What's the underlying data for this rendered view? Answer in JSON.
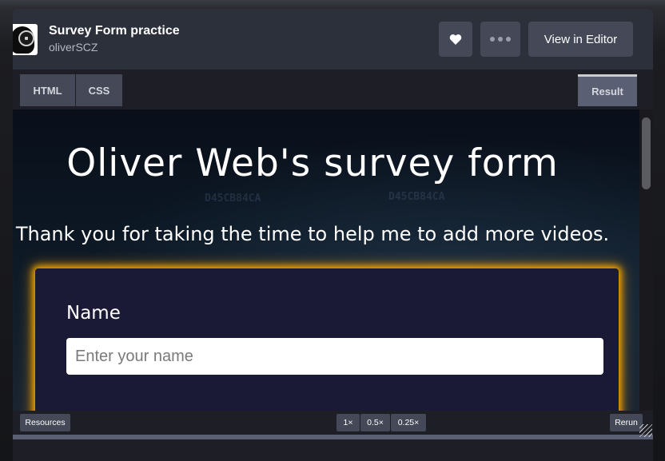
{
  "header": {
    "title": "Survey Form practice",
    "author": "oliverSCZ",
    "more_icon": "more-dots-icon",
    "heart_icon": "heart-icon",
    "view_in_editor_label": "View in Editor"
  },
  "tabs": {
    "html": "HTML",
    "css": "CSS",
    "result": "Result"
  },
  "result": {
    "heading": "Oliver Web's survey form",
    "description": "Thank you for taking the time to help me to add more videos.",
    "form": {
      "name_label": "Name",
      "name_placeholder": "Enter your name",
      "name_value": ""
    },
    "background_hex": [
      "D45CB84CA",
      "D45CB84CA"
    ],
    "accent_glow": "#f0a000",
    "card_bg": "#1b1a36"
  },
  "footer": {
    "resources_label": "Resources",
    "zoom_options": [
      "1×",
      "0.5×",
      "0.25×"
    ],
    "rerun_label": "Rerun"
  }
}
